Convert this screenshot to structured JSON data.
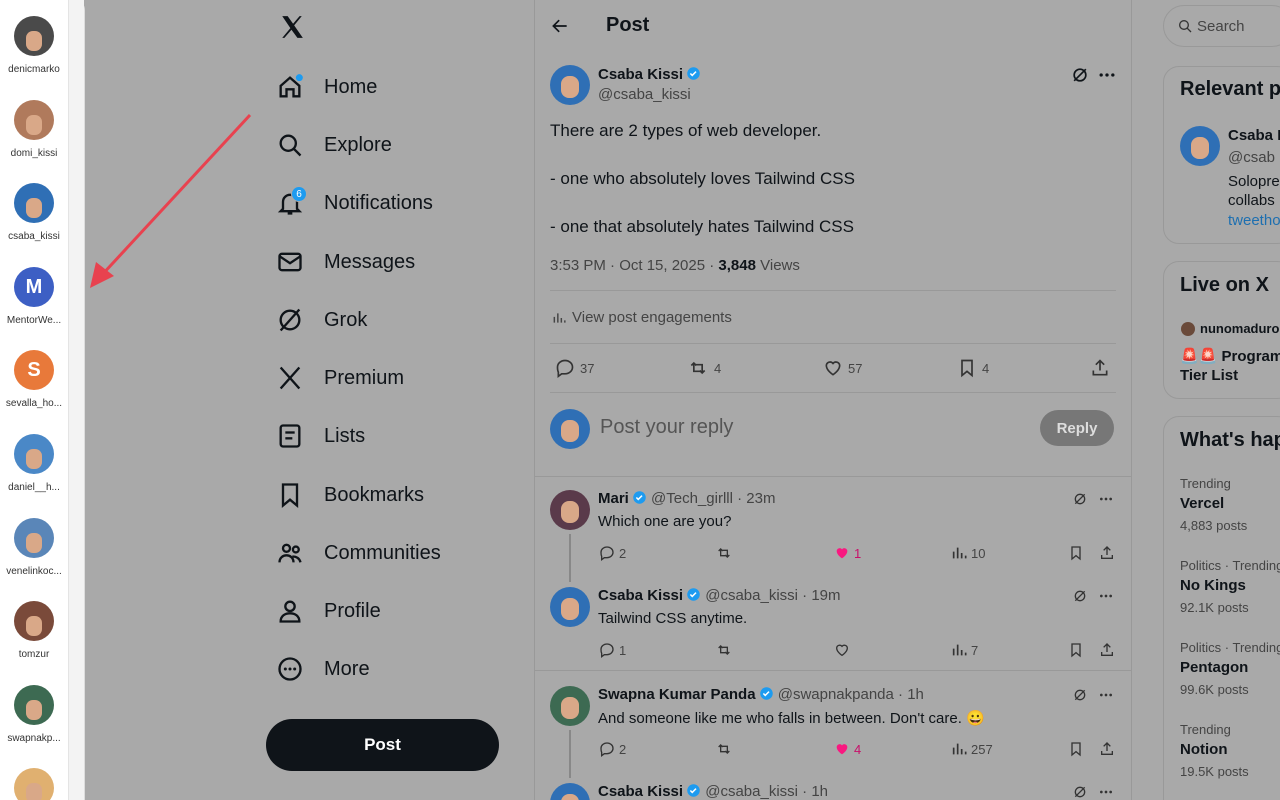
{
  "accounts": [
    {
      "name": "denicmarko",
      "color": "#4a4a4a",
      "initial": ""
    },
    {
      "name": "domi_kissi",
      "color": "#b07a5c",
      "initial": ""
    },
    {
      "name": "csaba_kissi",
      "color": "#2f6fb5",
      "initial": ""
    },
    {
      "name": "MentorWe...",
      "color": "#3d5fc4",
      "initial": "M"
    },
    {
      "name": "sevalla_ho...",
      "color": "#e8793a",
      "initial": "S"
    },
    {
      "name": "daniel__h...",
      "color": "#4a88c7",
      "initial": ""
    },
    {
      "name": "venelinkoc...",
      "color": "#5a86b8",
      "initial": ""
    },
    {
      "name": "tomzur",
      "color": "#7a4a3a",
      "initial": ""
    },
    {
      "name": "swapnakp...",
      "color": "#3d6a52",
      "initial": ""
    },
    {
      "name": "",
      "color": "#e0b070",
      "initial": ""
    }
  ],
  "nav": {
    "home": "Home",
    "explore": "Explore",
    "notifications": "Notifications",
    "notifications_count": "6",
    "messages": "Messages",
    "grok": "Grok",
    "premium": "Premium",
    "lists": "Lists",
    "bookmarks": "Bookmarks",
    "communities": "Communities",
    "profile": "Profile",
    "more": "More",
    "post_button": "Post"
  },
  "header": {
    "title": "Post"
  },
  "post": {
    "author": "Csaba Kissi",
    "handle": "@csaba_kissi",
    "line1": "There are 2 types of web developer.",
    "line2": "- one who absolutely loves Tailwind CSS",
    "line3": "- one that absolutely hates Tailwind CSS",
    "time": "3:53 PM · Oct 15, 2025 · ",
    "views_count": "3,848",
    "views_label": " Views",
    "engagements": "View post engagements",
    "replies": "37",
    "reposts": "4",
    "likes": "57",
    "bookmarks": "4"
  },
  "composer": {
    "placeholder": "Post your reply",
    "reply_button": "Reply"
  },
  "replies": [
    {
      "name": "Mari",
      "handle": "@Tech_girlll",
      "time": "· 23m",
      "text": "Which one are you?",
      "replies": "2",
      "reposts": "",
      "likes": "1",
      "views": "10"
    },
    {
      "name": "Csaba Kissi",
      "handle": "@csaba_kissi",
      "time": "· 19m",
      "text": "Tailwind CSS anytime.",
      "replies": "1",
      "reposts": "",
      "likes": "",
      "views": "7"
    },
    {
      "name": "Swapna Kumar Panda",
      "handle": "@swapnakpanda",
      "time": "· 1h",
      "text": "And someone like me who falls in between. Don't care. 😀",
      "replies": "2",
      "reposts": "",
      "likes": "4",
      "views": "257"
    },
    {
      "name": "Csaba Kissi",
      "handle": "@csaba_kissi",
      "time": "· 1h"
    }
  ],
  "search": {
    "placeholder": "Search"
  },
  "relevant": {
    "title": "Relevant p",
    "name": "Csaba I",
    "handle": "@csab",
    "bio1": "Solopre",
    "bio2": "collabs",
    "link": "tweetho"
  },
  "live": {
    "title": "Live on X",
    "host": "nunomaduro",
    "text1": "🚨🚨 Program",
    "text2": "Tier List"
  },
  "trends": {
    "title": "What's hap",
    "items": [
      {
        "context": "Trending",
        "name": "Vercel",
        "count": "4,883 posts"
      },
      {
        "context": "Politics · Trending",
        "name": "No Kings",
        "count": "92.1K posts"
      },
      {
        "context": "Politics · Trending",
        "name": "Pentagon",
        "count": "99.6K posts"
      },
      {
        "context": "Trending",
        "name": "Notion",
        "count": "19.5K posts"
      }
    ]
  },
  "colors": {
    "accent": "#1d9bf0",
    "like": "#f91880",
    "arrow": "#e8424f"
  }
}
